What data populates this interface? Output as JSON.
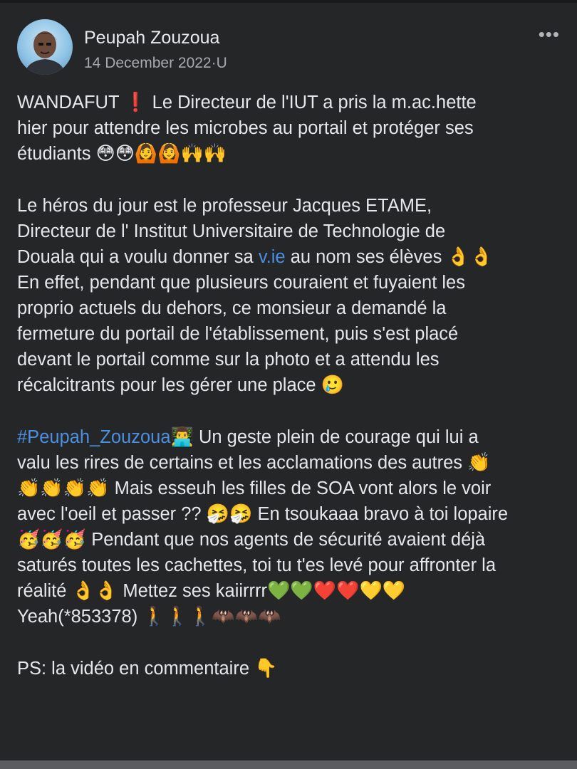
{
  "post": {
    "author": "Peupah Zouzoua",
    "date": "14 December 2022",
    "date_sep": "·",
    "visibility": "U",
    "more_label": "•••",
    "paragraphs": [
      {
        "lines": [
          [
            {
              "t": "WANDAFUT "
            },
            {
              "e": "❗",
              "c": "red"
            },
            {
              "t": " Le Directeur de l'IUT a pris la m.ac.hette"
            }
          ],
          [
            {
              "t": "hier pour attendre les microbes au portail et protéger ses"
            }
          ],
          [
            {
              "t": "étudiants "
            },
            {
              "e": "😳😳🙆🙆🙌🙌"
            }
          ]
        ]
      },
      {
        "lines": [
          [
            {
              "t": "Le héros du jour est le professeur Jacques ETAME,"
            }
          ],
          [
            {
              "t": "Directeur de l' Institut Universitaire de Technologie de"
            }
          ],
          [
            {
              "t": "Douala qui a voulu donner sa "
            },
            {
              "link": "v.ie"
            },
            {
              "t": " au nom ses élèves "
            },
            {
              "e": "👌👌"
            }
          ],
          [
            {
              "t": "En effet, pendant que plusieurs couraient et fuyaient les"
            }
          ],
          [
            {
              "t": "proprio actuels du dehors, ce monsieur a demandé la"
            }
          ],
          [
            {
              "t": "fermeture du portail de l'établissement, puis s'est placé"
            }
          ],
          [
            {
              "t": "devant le portail comme sur la photo et a attendu les"
            }
          ],
          [
            {
              "t": "récalcitrants pour les gérer une place "
            },
            {
              "e": "🥲"
            }
          ]
        ]
      },
      {
        "lines": [
          [
            {
              "link": "#Peupah_Zouzoua"
            },
            {
              "e": "👨‍💻"
            },
            {
              "t": " Un geste plein de courage qui lui a"
            }
          ],
          [
            {
              "t": "valu les rires de certains et les acclamations des autres "
            },
            {
              "e": "👏"
            }
          ],
          [
            {
              "e": "👏👏👏👏"
            },
            {
              "t": " Mais esseuh les filles de SOA vont alors le voir"
            }
          ],
          [
            {
              "t": "avec l'oeil et passer ?? "
            },
            {
              "e": "🤧🤧"
            },
            {
              "t": " En tsoukaaa bravo à toi lopaire"
            }
          ],
          [
            {
              "e": "🥳🥳🥳"
            },
            {
              "t": " Pendant que nos agents de sécurité avaient déjà"
            }
          ],
          [
            {
              "t": "saturés toutes les cachettes, toi tu t'es levé pour affronter la"
            }
          ],
          [
            {
              "t": "réalité "
            },
            {
              "e": "👌👌"
            },
            {
              "t": " Mettez ses kaiirrrr"
            },
            {
              "e": "💚💚❤️❤️💛💛"
            }
          ],
          [
            {
              "t": "Yeah(*853378) "
            },
            {
              "e": "🚶🚶🚶🦇🦇🦇"
            }
          ]
        ]
      },
      {
        "lines": [
          [
            {
              "t": "PS: la vidéo en commentaire "
            },
            {
              "e": "👇"
            }
          ]
        ]
      }
    ]
  }
}
